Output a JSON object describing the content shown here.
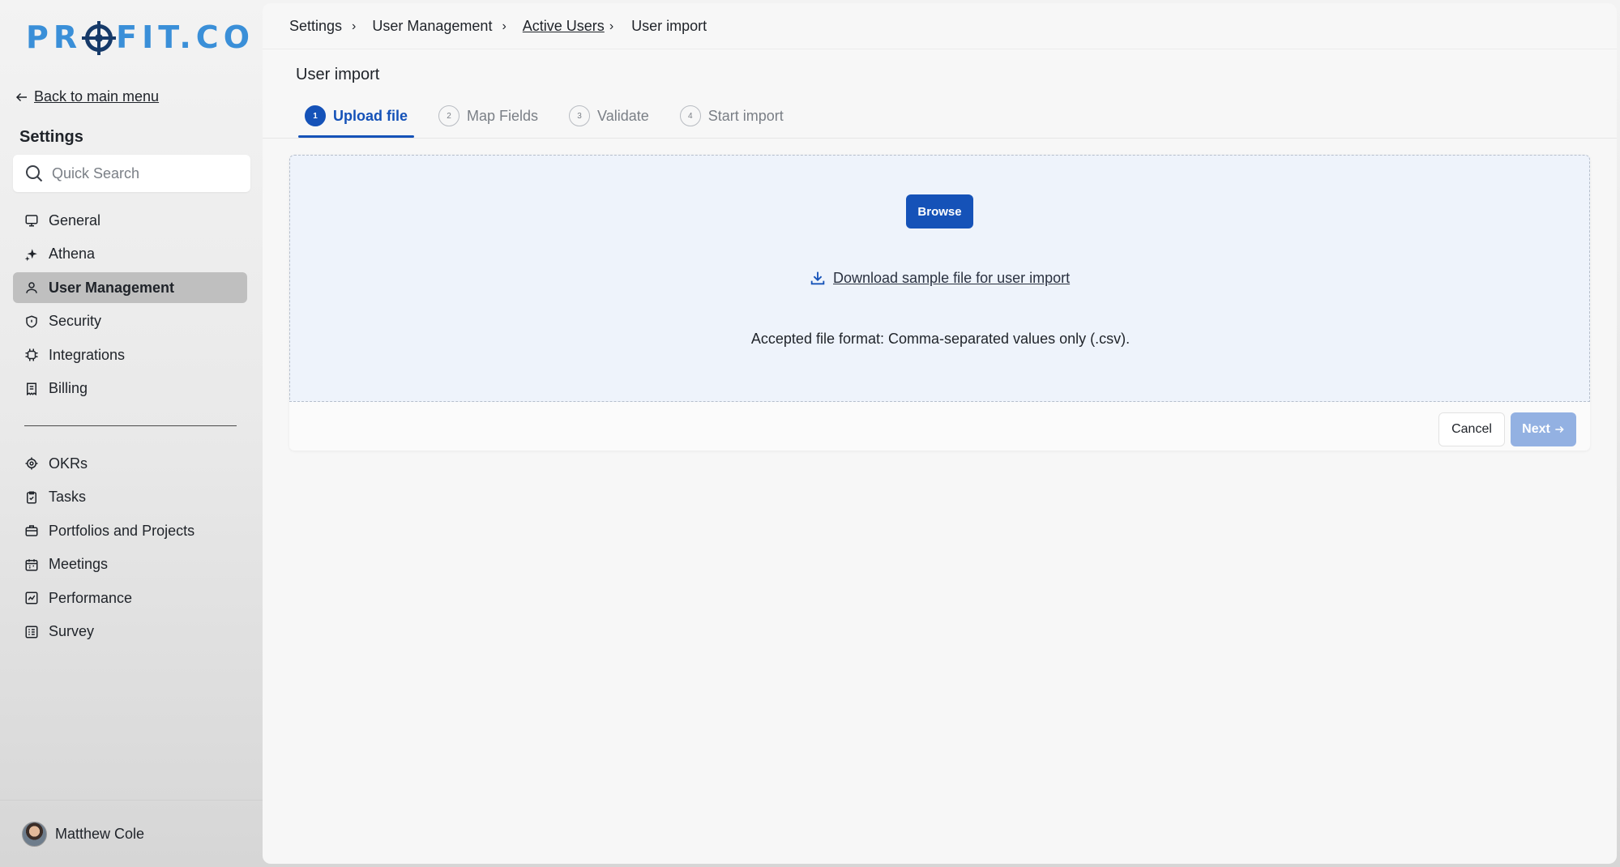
{
  "app": {
    "logo_text_left": "PR",
    "logo_text_right": "FIT.CO"
  },
  "sidebar": {
    "back_label": "Back to main menu",
    "heading": "Settings",
    "search_placeholder": "Quick Search",
    "items": [
      {
        "label": "General",
        "icon": "monitor-icon"
      },
      {
        "label": "Athena",
        "icon": "sparkle-icon"
      },
      {
        "label": "User Management",
        "icon": "user-icon",
        "active": true
      },
      {
        "label": "Security",
        "icon": "shield-icon"
      },
      {
        "label": "Integrations",
        "icon": "chip-icon"
      },
      {
        "label": "Billing",
        "icon": "receipt-icon"
      }
    ],
    "modules": [
      {
        "label": "OKRs",
        "icon": "target-icon"
      },
      {
        "label": "Tasks",
        "icon": "clipboard-check-icon"
      },
      {
        "label": "Portfolios and Projects",
        "icon": "briefcase-icon"
      },
      {
        "label": "Meetings",
        "icon": "calendar-icon"
      },
      {
        "label": "Performance",
        "icon": "chart-line-icon"
      },
      {
        "label": "Survey",
        "icon": "survey-icon"
      }
    ],
    "user_name": "Matthew Cole"
  },
  "breadcrumb": {
    "items": [
      "Settings",
      "User Management",
      "Active Users",
      "User import"
    ]
  },
  "page": {
    "title": "User import",
    "steps": [
      {
        "num": "1",
        "label": "Upload file",
        "active": true
      },
      {
        "num": "2",
        "label": "Map Fields"
      },
      {
        "num": "3",
        "label": "Validate"
      },
      {
        "num": "4",
        "label": "Start import"
      }
    ]
  },
  "upload": {
    "browse_label": "Browse",
    "download_label": "Download sample file for user import",
    "accepted_text": "Accepted file format: Comma-separated values only (.csv).",
    "cancel_label": "Cancel",
    "next_label": "Next"
  },
  "colors": {
    "accent": "#1552b8",
    "accent_disabled": "#93b1e2",
    "dropzone_bg": "#eef3fb"
  }
}
